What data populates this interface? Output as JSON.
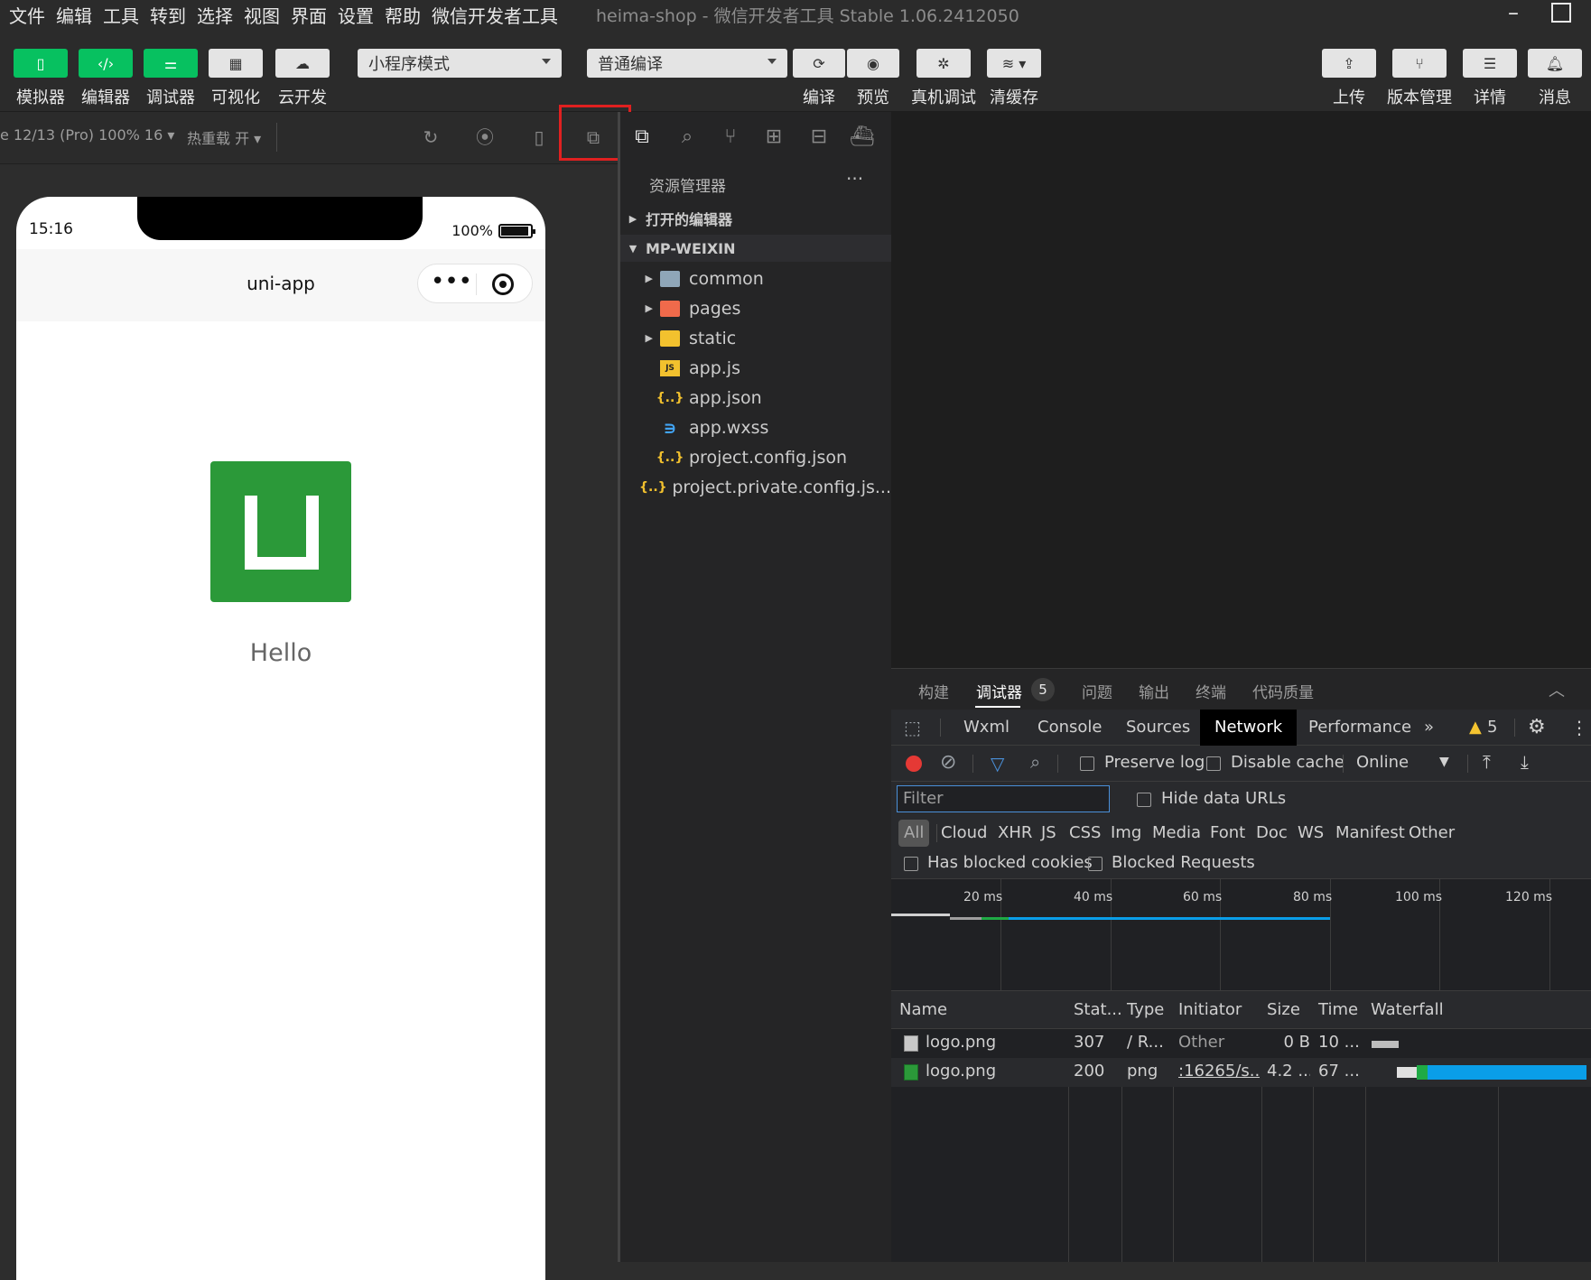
{
  "menubar": {
    "items": [
      "文件",
      "编辑",
      "工具",
      "转到",
      "选择",
      "视图",
      "界面",
      "设置",
      "帮助",
      "微信开发者工具"
    ],
    "window_title": "heima-shop - 微信开发者工具 Stable 1.06.2412050"
  },
  "toolbar": {
    "simulator": "模拟器",
    "editor": "编辑器",
    "debugger": "调试器",
    "visual": "可视化",
    "cloud": "云开发",
    "mode": "小程序模式",
    "compile_mode": "普通编译",
    "compile": "编译",
    "preview": "预览",
    "real_debug": "真机调试",
    "clear_cache": "清缓存",
    "upload": "上传",
    "version": "版本管理",
    "detail": "详情",
    "message": "消息"
  },
  "simbar": {
    "device": "e 12/13 (Pro) 100% 16 ▾",
    "hot_reload": "热重载 开 ▾"
  },
  "phone": {
    "time": "15:16",
    "battery": "100%",
    "nav_title": "uni-app",
    "hello": "Hello"
  },
  "explorer": {
    "title": "资源管理器",
    "more": "···",
    "open_editors": "打开的编辑器",
    "project": "MP-WEIXIN",
    "files": [
      {
        "name": "common",
        "icon": "folder-icon"
      },
      {
        "name": "pages",
        "icon": "pages-folder-icon"
      },
      {
        "name": "static",
        "icon": "static-folder-icon"
      },
      {
        "name": "app.js",
        "icon": "js-file-icon"
      },
      {
        "name": "app.json",
        "icon": "json-file-icon"
      },
      {
        "name": "app.wxss",
        "icon": "css-file-icon"
      },
      {
        "name": "project.config.json",
        "icon": "json-file-icon"
      },
      {
        "name": "project.private.config.js...",
        "icon": "json-file-icon"
      }
    ]
  },
  "panel": {
    "tabs": [
      "构建",
      "调试器",
      "问题",
      "输出",
      "终端",
      "代码质量"
    ],
    "debugger_badge": "5"
  },
  "devtools": {
    "tabs": [
      "Wxml",
      "Console",
      "Sources",
      "Network",
      "Performance"
    ],
    "more": "»",
    "warnings": "5"
  },
  "network": {
    "preserve_log": "Preserve log",
    "disable_cache": "Disable cache",
    "throttle": "Online",
    "filter_placeholder": "Filter",
    "hide_data_urls": "Hide data URLs",
    "types": [
      "All",
      "Cloud",
      "XHR",
      "JS",
      "CSS",
      "Img",
      "Media",
      "Font",
      "Doc",
      "WS",
      "Manifest",
      "Other"
    ],
    "has_blocked_cookies": "Has blocked cookies",
    "blocked_requests": "Blocked Requests",
    "ticks": [
      "20 ms",
      "40 ms",
      "60 ms",
      "80 ms",
      "100 ms",
      "120 ms"
    ],
    "columns": [
      "Name",
      "Stat...",
      "Type",
      "Initiator",
      "Size",
      "Time",
      "Waterfall"
    ],
    "rows": [
      {
        "name": "logo.png",
        "status": "307",
        "type": "/ R...",
        "initiator": "Other",
        "size": "0 B",
        "time": "10 ..."
      },
      {
        "name": "logo.png",
        "status": "200",
        "type": "png",
        "initiator": ":16265/s...",
        "size": "4.2 ...",
        "time": "67 ..."
      }
    ]
  },
  "colors": {
    "accent_green": "#07c160",
    "highlight_red": "#e02020",
    "record_red": "#e53935",
    "link_blue": "#1a73e8"
  }
}
